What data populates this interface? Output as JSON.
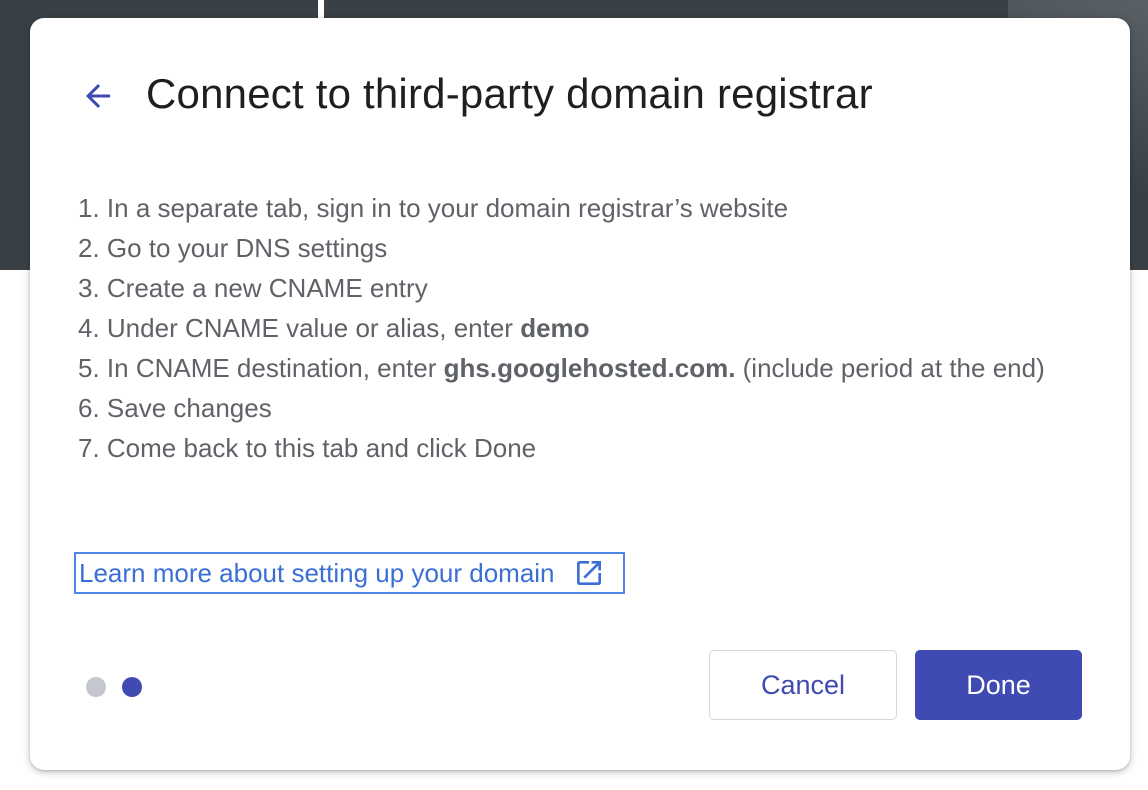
{
  "dialog": {
    "title": "Connect to third-party domain registrar",
    "steps": [
      {
        "prefix": "1. In a separate tab, sign in to your domain registrar’s website",
        "bold": "",
        "suffix": ""
      },
      {
        "prefix": "2. Go to your DNS settings",
        "bold": "",
        "suffix": ""
      },
      {
        "prefix": "3. Create a new CNAME entry",
        "bold": "",
        "suffix": ""
      },
      {
        "prefix": "4. Under CNAME value or alias, enter ",
        "bold": "demo",
        "suffix": ""
      },
      {
        "prefix": "5. In CNAME destination, enter ",
        "bold": "ghs.googlehosted.com.",
        "suffix": " (include period at the end)"
      },
      {
        "prefix": "6. Save changes",
        "bold": "",
        "suffix": ""
      },
      {
        "prefix": "7. Come back to this tab and click Done",
        "bold": "",
        "suffix": ""
      }
    ],
    "learn_more": "Learn more about setting up your domain",
    "pagination": {
      "total": 2,
      "current": 2
    },
    "buttons": {
      "cancel": "Cancel",
      "done": "Done"
    }
  },
  "icons": {
    "back": "arrow-back-icon",
    "external": "open-in-new-icon"
  },
  "colors": {
    "accent": "#3f4ab2",
    "link": "#3b6fd6",
    "text": "#5f6368",
    "title": "#1f1f1f",
    "dot_inactive": "#c4c7cb"
  }
}
